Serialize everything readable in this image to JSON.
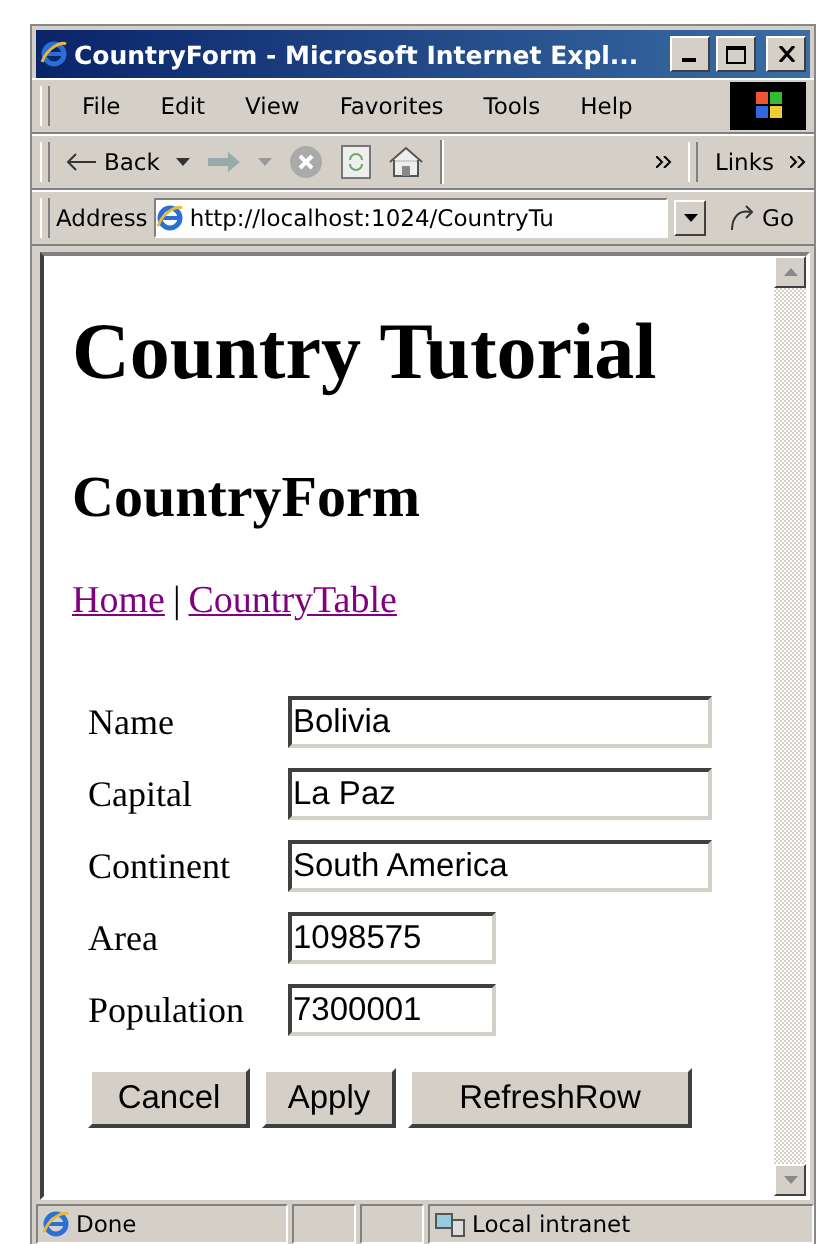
{
  "window": {
    "title": "CountryForm - Microsoft Internet Expl..."
  },
  "menu": [
    "File",
    "Edit",
    "View",
    "Favorites",
    "Tools",
    "Help"
  ],
  "toolbar": {
    "back": "Back",
    "links": "Links"
  },
  "address": {
    "label": "Address",
    "value": "http://localhost:1024/CountryTu",
    "go": "Go"
  },
  "page": {
    "title": "Country Tutorial",
    "subtitle": "CountryForm",
    "links": [
      "Home",
      "CountryTable"
    ],
    "separator": "|",
    "fields": [
      {
        "label": "Name",
        "value": "Bolivia",
        "kind": "long"
      },
      {
        "label": "Capital",
        "value": "La Paz",
        "kind": "long"
      },
      {
        "label": "Continent",
        "value": "South America",
        "kind": "long"
      },
      {
        "label": "Area",
        "value": "1098575",
        "kind": "short"
      },
      {
        "label": "Population",
        "value": "7300001",
        "kind": "short"
      }
    ],
    "buttons": [
      {
        "label": "Cancel",
        "kind": "small"
      },
      {
        "label": "Apply",
        "kind": "small"
      },
      {
        "label": "RefreshRow",
        "kind": "wide"
      }
    ]
  },
  "status_bar": {
    "text": "Done",
    "zone": "Local intranet"
  }
}
